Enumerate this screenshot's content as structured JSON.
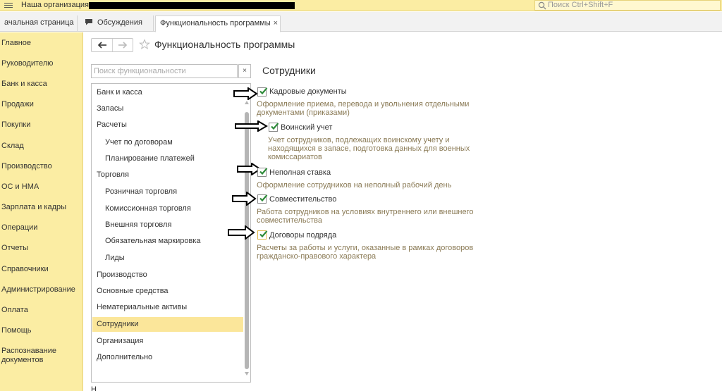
{
  "topbar": {
    "org_title": "Наша организация",
    "search_placeholder": "Поиск Ctrl+Shift+F"
  },
  "tabs": [
    {
      "label": "ачальная страница"
    },
    {
      "label": "Обсуждения"
    },
    {
      "label": "Функциональность программы",
      "close": "×"
    }
  ],
  "sidebar": {
    "items": [
      {
        "label": "Главное"
      },
      {
        "label": "Руководителю"
      },
      {
        "label": "Банк и касса"
      },
      {
        "label": "Продажи"
      },
      {
        "label": "Покупки"
      },
      {
        "label": "Склад"
      },
      {
        "label": "Производство"
      },
      {
        "label": "ОС и НМА"
      },
      {
        "label": "Зарплата и кадры"
      },
      {
        "label": "Операции"
      },
      {
        "label": "Отчеты"
      },
      {
        "label": "Справочники"
      },
      {
        "label": "Администрирование"
      },
      {
        "label": "Оплата"
      },
      {
        "label": "Помощь"
      },
      {
        "label": "Распознавание документов"
      }
    ]
  },
  "header": {
    "title": "Функциональность программы"
  },
  "function_search": {
    "placeholder": "Поиск функциональности",
    "clear": "×"
  },
  "sections": {
    "items": [
      {
        "label": "Банк и касса"
      },
      {
        "label": "Запасы"
      },
      {
        "label": "Расчеты"
      },
      {
        "label": "Учет по договорам"
      },
      {
        "label": "Планирование платежей"
      },
      {
        "label": "Торговля"
      },
      {
        "label": "Розничная торговля"
      },
      {
        "label": "Комиссионная торговля"
      },
      {
        "label": "Внешняя торговля"
      },
      {
        "label": "Обязательная маркировка"
      },
      {
        "label": "Лиды"
      },
      {
        "label": "Производство"
      },
      {
        "label": "Основные средства"
      },
      {
        "label": "Нематериальные активы"
      },
      {
        "label": "Сотрудники"
      },
      {
        "label": "Организация"
      },
      {
        "label": "Дополнительно"
      }
    ],
    "selected": "Сотрудники"
  },
  "content": {
    "section_title": "Сотрудники",
    "options": [
      {
        "label": "Кадровые документы",
        "checked": true,
        "desc": "Оформление приема, перевода и увольнения отдельными документами (приказами)"
      },
      {
        "label": "Воинский учет",
        "checked": true,
        "desc": "Учет сотрудников, подлежащих воинскому учету и находящихся в запасе, подготовка данных для военных комиссариатов"
      },
      {
        "label": "Неполная ставка",
        "checked": true,
        "desc": "Оформление сотрудников на неполный рабочий день"
      },
      {
        "label": "Совместительство",
        "checked": true,
        "desc": "Работа сотрудников на условиях внутреннего или внешнего совместительства"
      },
      {
        "label": "Договоры подряда",
        "checked": true,
        "desc": "Расчеты за работы и услуги, оказанные в рамках договоров гражданско-правового характера"
      }
    ]
  },
  "colors": {
    "sidebar_bg": "#fbeda3",
    "selected_bg": "#fbe69a",
    "check_green": "#2e8b3a",
    "desc_text": "#8a7a55"
  },
  "footer": {
    "partial_text": "Н"
  }
}
